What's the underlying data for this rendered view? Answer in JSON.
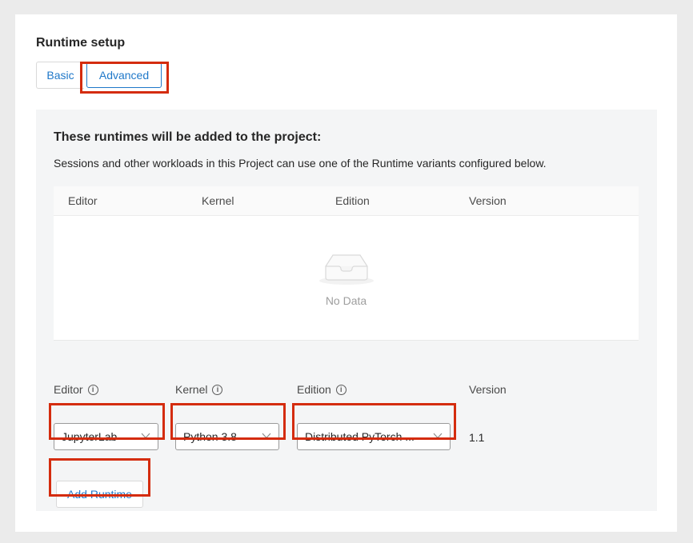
{
  "runtime_setup": {
    "title": "Runtime setup",
    "tabs": [
      {
        "label": "Basic",
        "selected": false
      },
      {
        "label": "Advanced",
        "selected": true
      }
    ]
  },
  "panel": {
    "title": "These runtimes will be added to the project:",
    "description": "Sessions and other workloads in this Project can use one of the Runtime variants configured below.",
    "table": {
      "columns": [
        "Editor",
        "Kernel",
        "Edition",
        "Version"
      ],
      "rows": [],
      "empty_text": "No Data",
      "empty_icon": "inbox-icon"
    }
  },
  "form": {
    "editor": {
      "label": "Editor",
      "value": "JupyterLab"
    },
    "kernel": {
      "label": "Kernel",
      "value": "Python 3.8"
    },
    "edition": {
      "label": "Edition",
      "value": "Distributed PyTorch ..."
    },
    "version": {
      "label": "Version",
      "value": "1.1"
    },
    "add_button": "Add Runtime"
  },
  "colors": {
    "accent": "#1f78c9",
    "highlight": "#d42c0e",
    "panel_bg": "#f4f5f6"
  }
}
